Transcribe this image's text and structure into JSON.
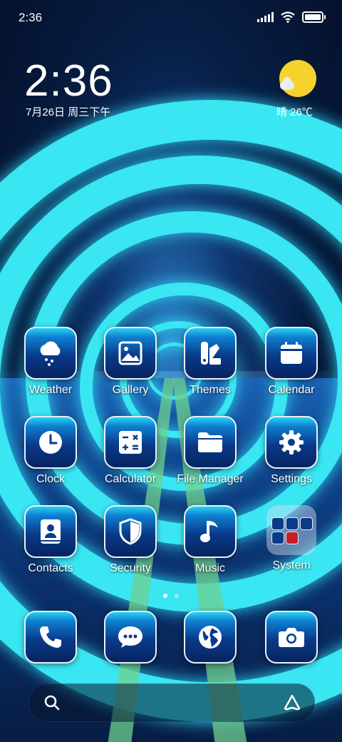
{
  "status_bar": {
    "time": "2:36"
  },
  "widget": {
    "time": "2:36",
    "date": "7月26日 周三下午",
    "weather": "晴 26℃",
    "sun_color": "#F8D22C"
  },
  "apps": [
    {
      "label": "Weather",
      "icon": "cloud-rain-icon"
    },
    {
      "label": "Gallery",
      "icon": "image-icon"
    },
    {
      "label": "Themes",
      "icon": "themes-brush-icon"
    },
    {
      "label": "Calendar",
      "icon": "calendar-icon"
    },
    {
      "label": "Clock",
      "icon": "clock-icon"
    },
    {
      "label": "Calculator",
      "icon": "calculator-icon"
    },
    {
      "label": "File Manager",
      "icon": "folder-icon"
    },
    {
      "label": "Settings",
      "icon": "gear-icon"
    },
    {
      "label": "Contacts",
      "icon": "contacts-book-icon"
    },
    {
      "label": "Security",
      "icon": "shield-icon"
    },
    {
      "label": "Music",
      "icon": "music-note-icon"
    },
    {
      "label": "System",
      "icon": "folder-grid-icon"
    }
  ],
  "dock": [
    {
      "icon": "phone-icon"
    },
    {
      "icon": "chat-bubble-icon"
    },
    {
      "icon": "globe-icon"
    },
    {
      "icon": "camera-icon"
    }
  ],
  "page_indicator": {
    "total": 2,
    "current": 1
  },
  "colors": {
    "accent_ring": "#39E6F2",
    "tile_top": "#29D2F2",
    "tile_bottom": "#06245F"
  }
}
